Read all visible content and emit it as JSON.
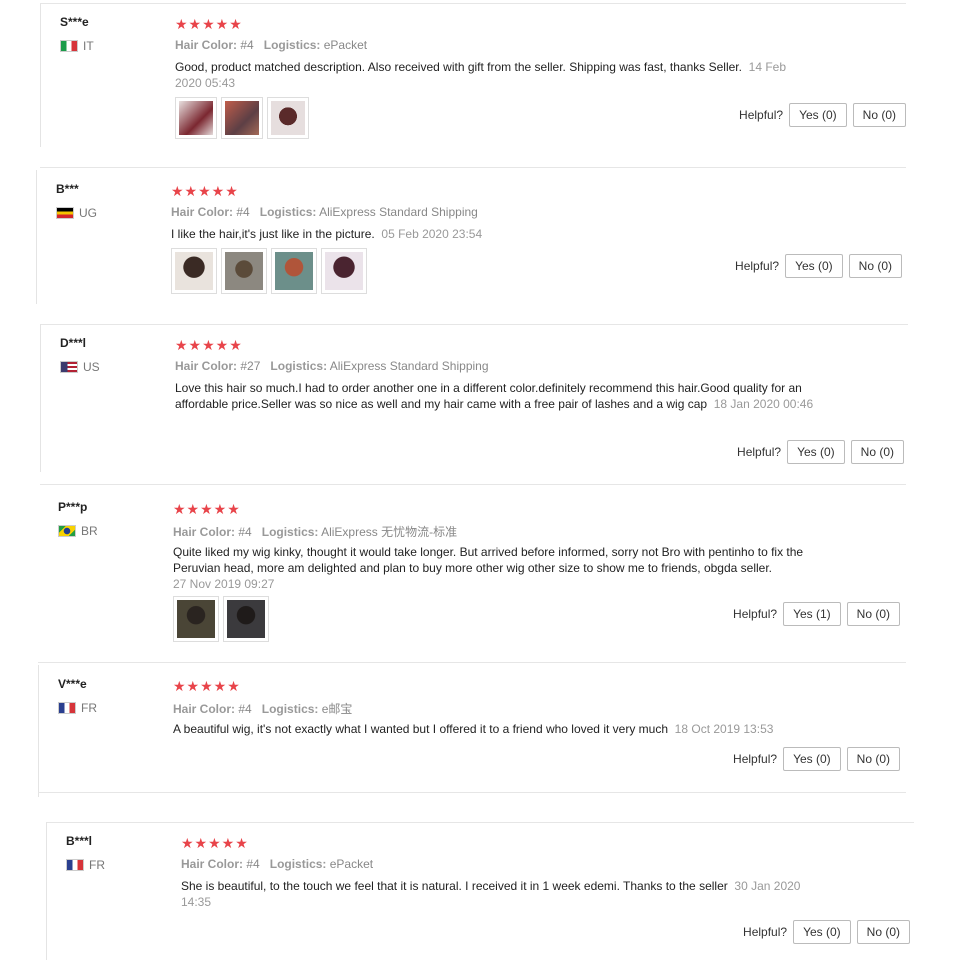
{
  "helpful_label": "Helpful?",
  "hair_color_label": "Hair Color:",
  "logistics_label": "Logistics:",
  "reviews": [
    {
      "user": "S***e",
      "country": "IT",
      "flag": "italy-flag-icon",
      "stars": "★★★★★",
      "hair_color": "#4",
      "logistics": "ePacket",
      "text": "Good, product matched description. Also received with gift from the seller. Shipping was fast, thanks Seller.",
      "time": "14 Feb 2020 05:43",
      "yes": "Yes (0)",
      "no": "No (0)",
      "thumbs": [
        "#7b2730",
        "#c05d4b",
        "#5a2a2a"
      ]
    },
    {
      "user": "B***",
      "country": "UG",
      "flag": "uganda-flag-icon",
      "stars": "★★★★★",
      "hair_color": "#4",
      "logistics": "AliExpress Standard Shipping",
      "text": "I like the hair,it's just like in the picture.",
      "time": "05 Feb 2020 23:54",
      "yes": "Yes (0)",
      "no": "No (0)",
      "thumbs": [
        "#3a2a24",
        "#5b4b3a",
        "#6c8f8a",
        "#4a2430"
      ]
    },
    {
      "user": "D***l",
      "country": "US",
      "flag": "usa-flag-icon",
      "stars": "★★★★★",
      "hair_color": "#27",
      "logistics": "AliExpress Standard Shipping",
      "text": "Love this hair so much.I had to order another one in a different color.definitely recommend this hair.Good quality for an affordable price.Seller was so nice as well and my hair came with a free pair of lashes and a wig cap",
      "time": "18 Jan 2020 00:46",
      "yes": "Yes (0)",
      "no": "No (0)",
      "thumbs": []
    },
    {
      "user": "P***p",
      "country": "BR",
      "flag": "brazil-flag-icon",
      "stars": "★★★★★",
      "hair_color": "#4",
      "logistics": "AliExpress 无忧物流-标准",
      "text": "Quite liked my wig kinky, thought it would take longer. But arrived before informed, sorry not Bro with pentinho to fix the Peruvian head, more am delighted and plan to buy more other wig other size to show me to friends, obgda seller.",
      "time": "27 Nov 2019 09:27",
      "yes": "Yes (1)",
      "no": "No (0)",
      "thumbs": [
        "#4a4536",
        "#3b3a3d"
      ]
    },
    {
      "user": "V***e",
      "country": "FR",
      "flag": "france-flag-icon",
      "stars": "★★★★★",
      "hair_color": "#4",
      "logistics": "e邮宝",
      "text": "A beautiful wig, it's not exactly what I wanted but I offered it to a friend who loved it very much",
      "time": "18 Oct 2019 13:53",
      "yes": "Yes (0)",
      "no": "No (0)",
      "thumbs": []
    },
    {
      "user": "B***l",
      "country": "FR",
      "flag": "france-flag-icon",
      "stars": "★★★★★",
      "hair_color": "#4",
      "logistics": "ePacket",
      "text": "She is beautiful, to the touch we feel that it is natural. I received it in 1 week edemi. Thanks to the seller",
      "time": "30 Jan 2020 14:35",
      "yes": "Yes (0)",
      "no": "No (0)",
      "thumbs": []
    }
  ]
}
